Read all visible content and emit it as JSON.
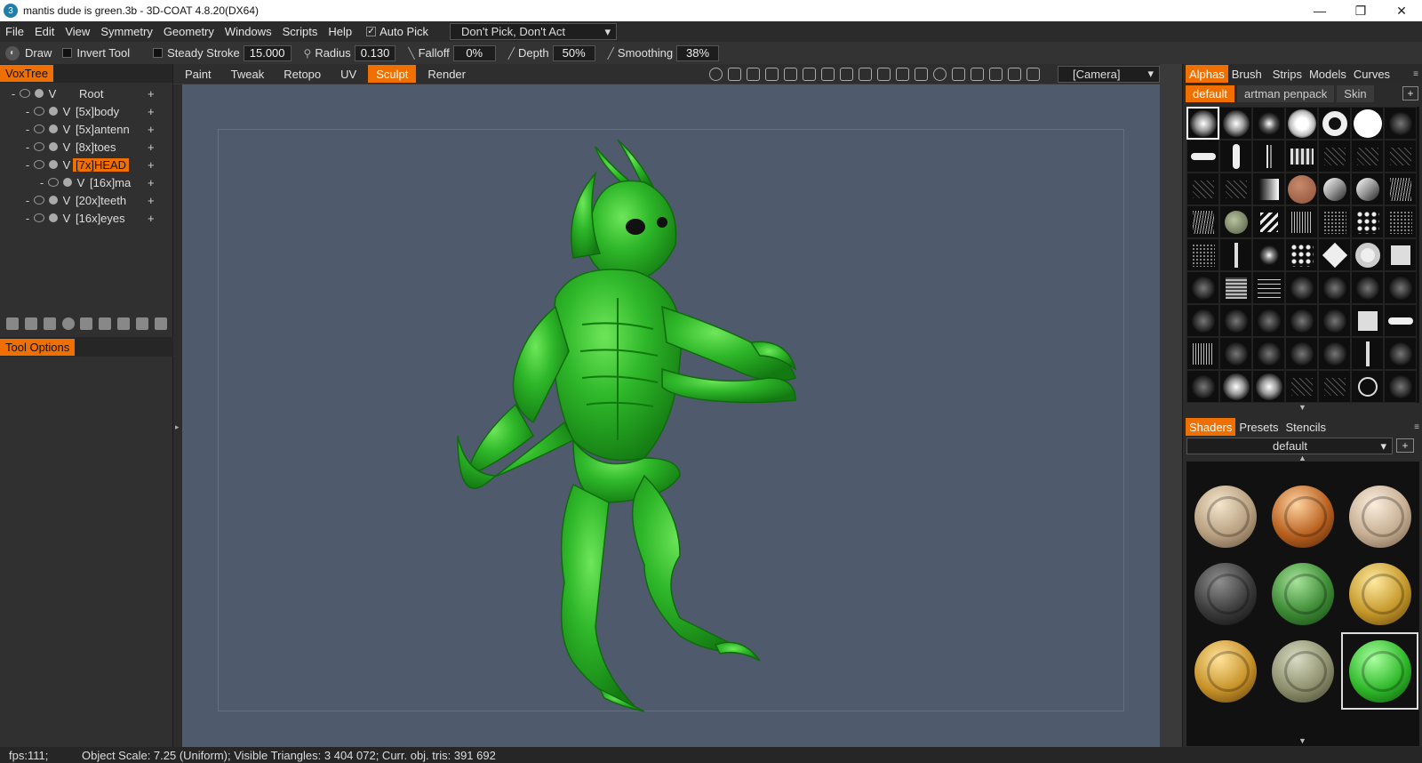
{
  "window": {
    "title": "mantis dude is green.3b - 3D-COAT 4.8.20(DX64)",
    "minimize": "—",
    "restore": "❐",
    "close": "✕"
  },
  "menu": {
    "items": [
      "File",
      "Edit",
      "View",
      "Symmetry",
      "Geometry",
      "Windows",
      "Scripts",
      "Help"
    ],
    "auto_pick_check": "✓",
    "auto_pick": "Auto Pick",
    "pick_mode": "Don't Pick, Don't Act",
    "dropdown_arrow": "▾"
  },
  "toolstrip": {
    "tool": "Draw",
    "invert_tool": "Invert Tool",
    "steady_stroke": "Steady Stroke",
    "steady_stroke_value": "15.000",
    "radius": "Radius",
    "radius_value": "0.130",
    "falloff": "Falloff",
    "falloff_value": "0%",
    "depth": "Depth",
    "depth_value": "50%",
    "smoothing": "Smoothing",
    "smoothing_value": "38%"
  },
  "voxtree": {
    "tab": "VoxTree",
    "items": [
      {
        "name": "Root",
        "depth": 0
      },
      {
        "name": "[5x]body",
        "depth": 1
      },
      {
        "name": "[5x]antenn",
        "depth": 1
      },
      {
        "name": "[8x]toes",
        "depth": 1
      },
      {
        "name": "[7x]HEAD",
        "depth": 1,
        "selected": true
      },
      {
        "name": "[16x]ma",
        "depth": 2
      },
      {
        "name": "[20x]teeth",
        "depth": 1
      },
      {
        "name": "[16x]eyes",
        "depth": 1
      }
    ],
    "v_letter": "V",
    "plus": "+",
    "dash": "-"
  },
  "tool_options": {
    "tab": "Tool Options"
  },
  "modes": {
    "items": [
      "Paint",
      "Tweak",
      "Retopo",
      "UV",
      "Sculpt",
      "Render"
    ],
    "active": "Sculpt",
    "camera": "[Camera]"
  },
  "right_panel": {
    "tabs": [
      "Alphas",
      "Brush",
      "Strips",
      "Models",
      "Curves"
    ],
    "active_tab": "Alphas",
    "subtabs": [
      "default",
      "artman penpack",
      "Skin"
    ],
    "active_subtab": "default",
    "add": "+",
    "shader_tabs": [
      "Shaders",
      "Presets",
      "Stencils"
    ],
    "active_shader_tab": "Shaders",
    "shader_preset": "default",
    "scroll_up": "▲",
    "scroll_down": "▼"
  },
  "colors": {
    "accent": "#ef6f00",
    "viewport": "#4f5b6c",
    "model_green": "#2fb82a"
  },
  "status": {
    "fps": "fps:111;",
    "info": "Object Scale: 7.25 (Uniform); Visible Triangles: 3 404 072; Curr. obj. tris: 391 692"
  }
}
